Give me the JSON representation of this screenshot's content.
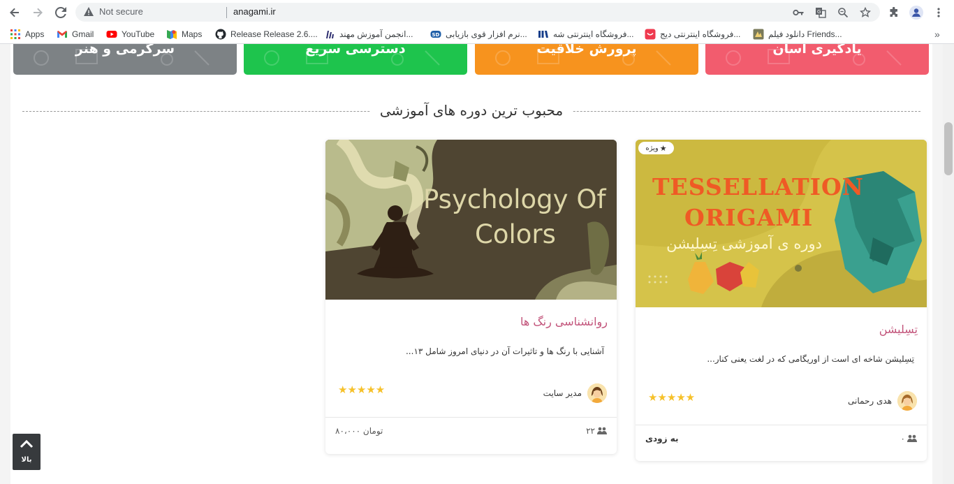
{
  "browser": {
    "security_label": "Not secure",
    "url": "anagami.ir",
    "bookmarks": [
      {
        "label": "Apps",
        "icon": "apps-grid-icon"
      },
      {
        "label": "Gmail",
        "icon": "gmail-icon"
      },
      {
        "label": "YouTube",
        "icon": "youtube-icon"
      },
      {
        "label": "Maps",
        "icon": "maps-icon"
      },
      {
        "label": "Release Release 2.6....",
        "icon": "github-icon"
      },
      {
        "label": "انجمن آموزش مهند...",
        "icon": "forum-icon"
      },
      {
        "label": "نرم افزار قوی بازیابی...",
        "icon": "recovery-software-icon"
      },
      {
        "label": "فروشگاه اینترنتی شه...",
        "icon": "store-icon"
      },
      {
        "label": "فروشگاه اینترنتی دیج...",
        "icon": "digikala-icon"
      },
      {
        "label": "دانلود فیلم Friends...",
        "icon": "movie-icon"
      }
    ],
    "bookmarks_overflow": "»"
  },
  "categories": [
    {
      "label": "سرگرمی و هنر",
      "color": "#7d8285"
    },
    {
      "label": "دسترسی سریع",
      "color": "#1ec44d"
    },
    {
      "label": "پرورش خلاقیت",
      "color": "#f7931e"
    },
    {
      "label": "یادگیری آسان",
      "color": "#f25c6e"
    }
  ],
  "section": {
    "title": "محبوب ترین دوره های آموزشی"
  },
  "courses": [
    {
      "title": "تِسِلیشن",
      "badge": "ویژه",
      "image_text_line1": "TESSELLATION",
      "image_text_line2": "ORIGAMI",
      "image_text_line3": "دوره ی آموزشی تِسِلیشن",
      "description": "تِسِلیشن شاخه ای است از اوریگامی که در لغت یعنی کنار...",
      "rating": 5,
      "stars": "★★★★★",
      "author": "هدی رحمانی",
      "students": "۰",
      "price": "به زودی"
    },
    {
      "title": "روانشناسی رنگ ها",
      "image_text_line1": "Psychology Of",
      "image_text_line2": "Colors",
      "description": "آشنایی با رنگ ها و تاثیرات آن در دنیای امروز شامل ۱۳...",
      "rating": 5,
      "stars": "★★★★★",
      "author": "مدیر سایت",
      "students": "۲۲",
      "price": "۸۰،۰۰۰ تومان"
    }
  ],
  "back_to_top": {
    "label": "بالا"
  }
}
